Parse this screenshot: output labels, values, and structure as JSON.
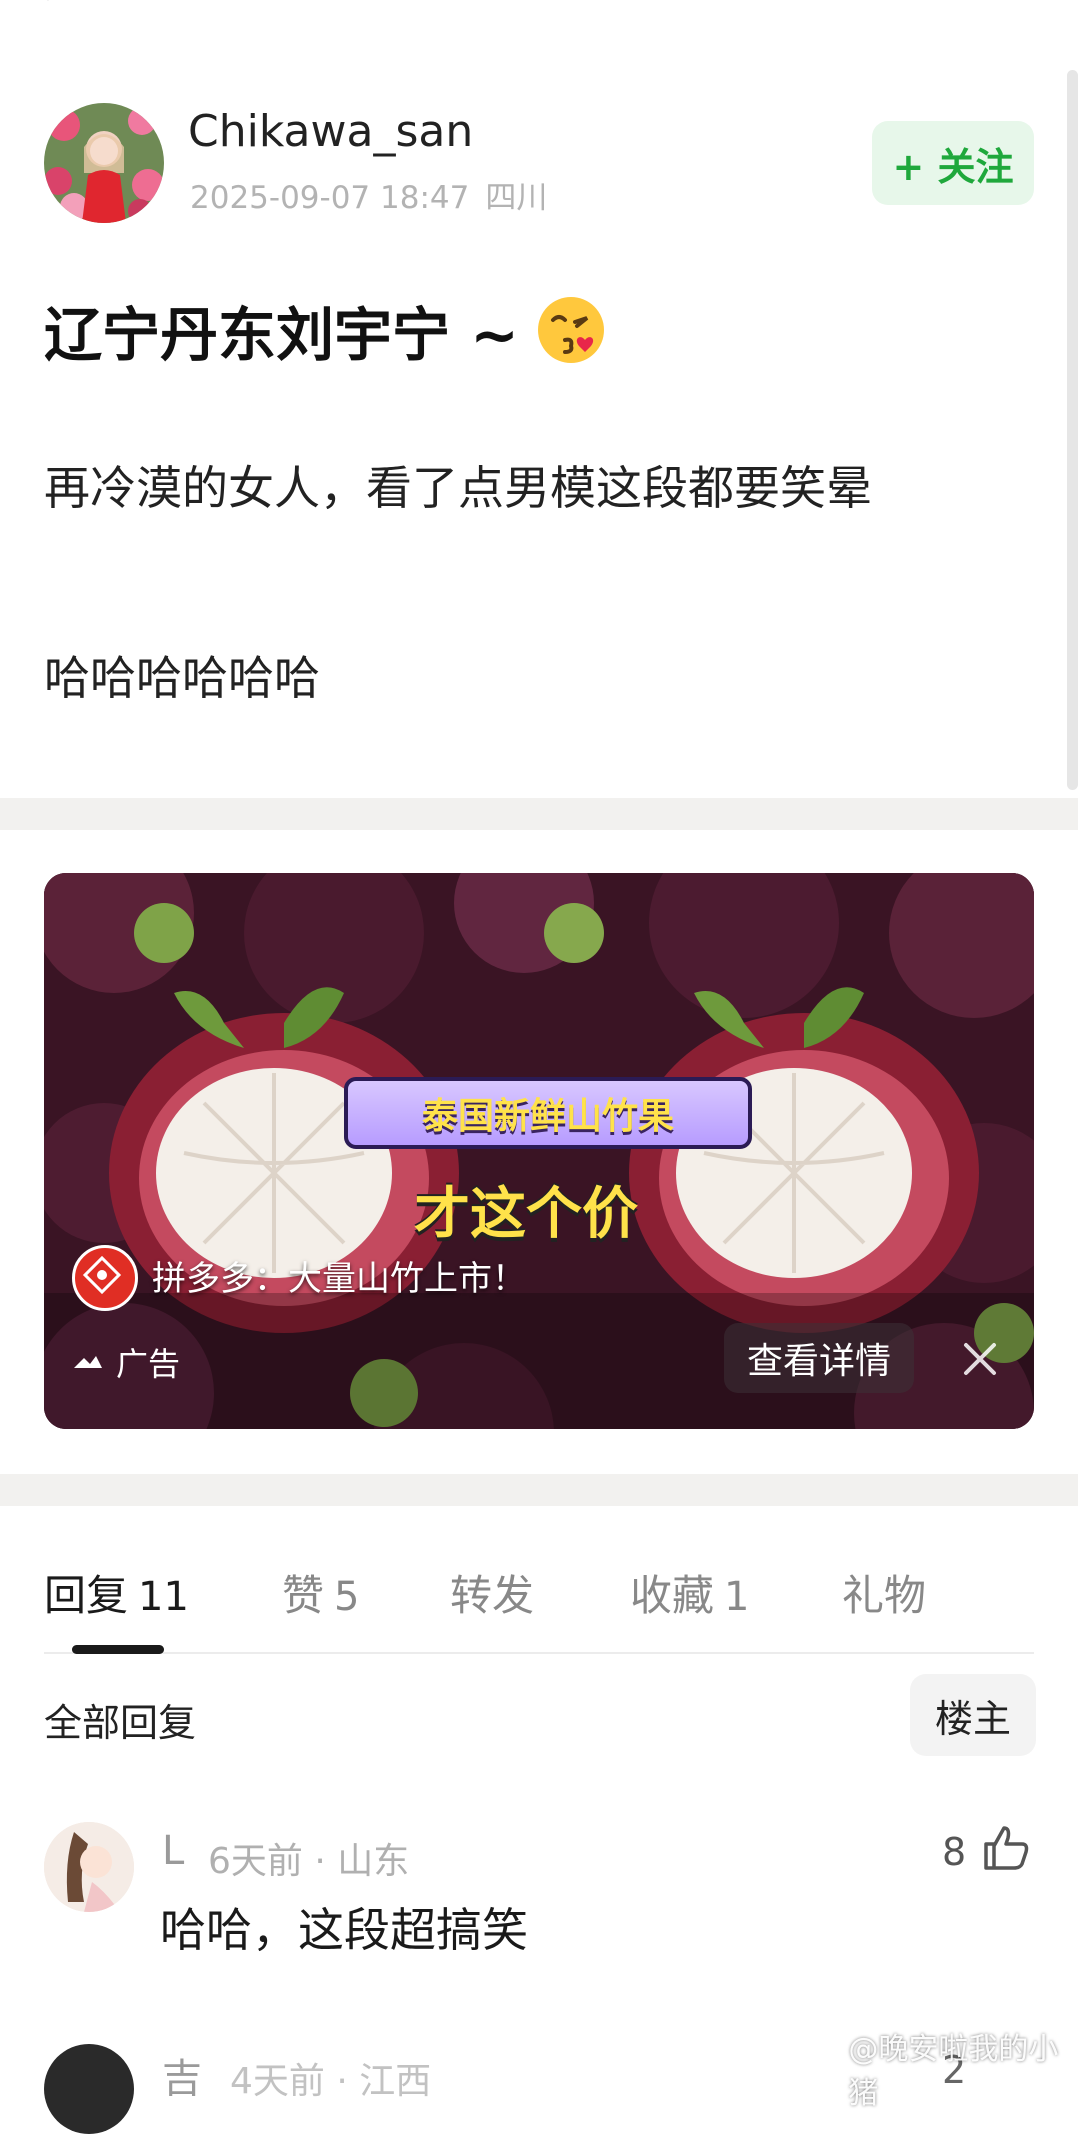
{
  "post": {
    "author": "Chikawa_san",
    "timestamp": "2025-09-07 18:47",
    "location": "四川",
    "follow_label": "+ 关注",
    "title": "辽宁丹东刘宇宁 ~",
    "title_emoji": "face-blowing-kiss-icon",
    "body_line1": "再冷漠的女人，看了点男模这段都要笑晕",
    "body_line2": "哈哈哈哈哈哈"
  },
  "ad": {
    "banner": "泰国新鲜山竹果",
    "price_text": "才这个价",
    "slogan": "拼多多：大量山竹上市！",
    "label": "广告",
    "details_label": "查看详情"
  },
  "tabs": [
    {
      "label": "回复",
      "count": "11"
    },
    {
      "label": "赞",
      "count": "5"
    },
    {
      "label": "转发",
      "count": ""
    },
    {
      "label": "收藏",
      "count": "1"
    },
    {
      "label": "礼物",
      "count": ""
    }
  ],
  "replies": {
    "header": "全部回复",
    "owner_filter": "楼主",
    "items": [
      {
        "user": "L",
        "meta": "6天前 · 山东",
        "text": "哈哈，这段超搞笑",
        "likes": "8"
      },
      {
        "user": "吉",
        "meta": "4天前 · 江西",
        "text": "",
        "likes": "2"
      }
    ]
  },
  "watermark": "@晚安啦我的小猪",
  "colors": {
    "follow_green": "#1fa83c",
    "follow_bg": "#e7f7ea",
    "band_gray": "#f2f1ef",
    "muted_text": "#b3b3b3"
  }
}
